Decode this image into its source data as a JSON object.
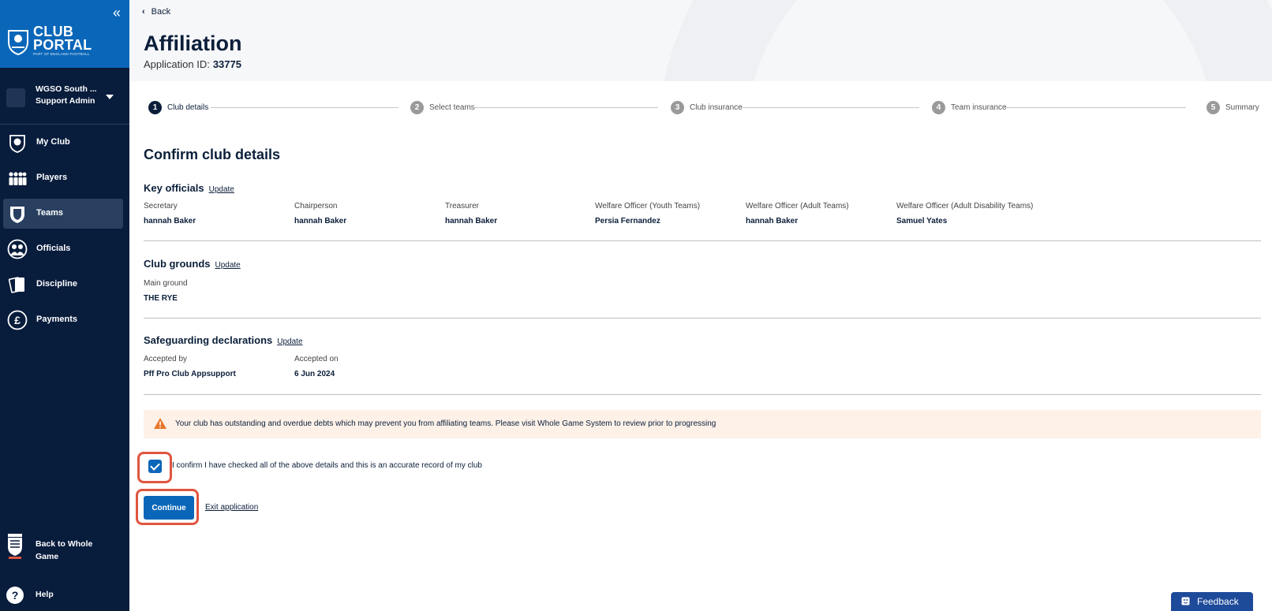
{
  "sidebar": {
    "brand": {
      "line1": "CLUB",
      "line2": "PORTAL",
      "sub": "PART OF ENGLAND FOOTBALL"
    },
    "account": {
      "name": "WGSO South ...",
      "role": "Support Admin"
    },
    "nav": [
      {
        "label": "My Club",
        "icon": "club-badge-icon"
      },
      {
        "label": "Players",
        "icon": "players-icon"
      },
      {
        "label": "Teams",
        "icon": "teams-shield-icon",
        "active": true
      },
      {
        "label": "Officials",
        "icon": "officials-icon"
      },
      {
        "label": "Discipline",
        "icon": "discipline-cards-icon"
      },
      {
        "label": "Payments",
        "icon": "pound-icon"
      }
    ],
    "back_to_whole_game": "Back to Whole Game",
    "help": "Help"
  },
  "header": {
    "back": "Back",
    "title": "Affiliation",
    "app_id_label": "Application ID:",
    "app_id_value": "33775"
  },
  "stepper": [
    {
      "num": "1",
      "label": "Club details",
      "current": true
    },
    {
      "num": "2",
      "label": "Select teams"
    },
    {
      "num": "3",
      "label": "Club insurance"
    },
    {
      "num": "4",
      "label": "Team insurance"
    },
    {
      "num": "5",
      "label": "Summary"
    }
  ],
  "confirm_title": "Confirm club details",
  "key_officials": {
    "title": "Key officials",
    "update": "Update",
    "fields": [
      {
        "label": "Secretary",
        "value": "hannah Baker"
      },
      {
        "label": "Chairperson",
        "value": "hannah Baker"
      },
      {
        "label": "Treasurer",
        "value": "hannah Baker"
      },
      {
        "label": "Welfare Officer (Youth Teams)",
        "value": "Persia Fernandez"
      },
      {
        "label": "Welfare Officer (Adult Teams)",
        "value": "hannah Baker"
      },
      {
        "label": "Welfare Officer (Adult Disability Teams)",
        "value": "Samuel Yates"
      }
    ]
  },
  "club_grounds": {
    "title": "Club grounds",
    "update": "Update",
    "fields": [
      {
        "label": "Main ground",
        "value": "THE RYE"
      }
    ]
  },
  "safeguarding": {
    "title": "Safeguarding declarations",
    "update": "Update",
    "fields": [
      {
        "label": "Accepted by",
        "value": "Pff Pro Club Appsupport"
      },
      {
        "label": "Accepted on",
        "value": "6 Jun 2024"
      }
    ]
  },
  "warning": "Your club has outstanding and overdue debts which may prevent you from affiliating teams. Please visit Whole Game System to review prior to progressing",
  "confirm_checkbox": "I confirm I have checked all of the above details and this is an accurate record of my club",
  "continue": "Continue",
  "exit": "Exit application",
  "feedback": "Feedback",
  "colors": {
    "sidebar": "#081c3c",
    "brand": "#0a66b8",
    "primary": "#0a66b8",
    "highlight": "#e0553f",
    "warning_bg": "#fdf1e8"
  }
}
